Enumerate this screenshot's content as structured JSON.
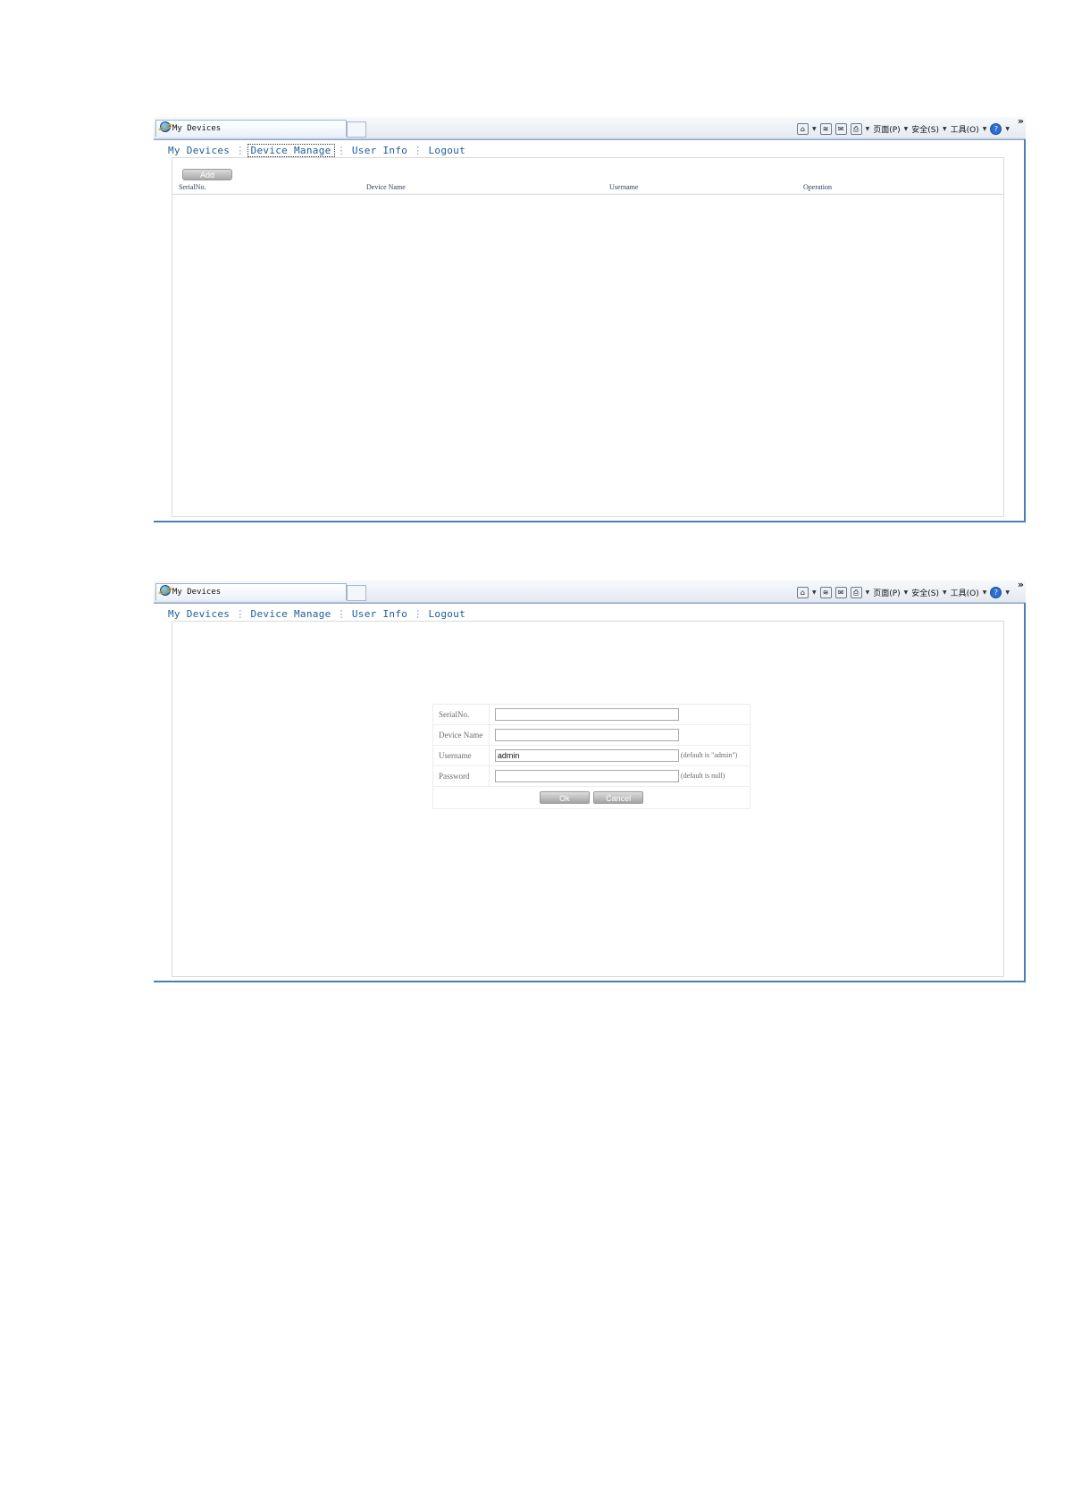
{
  "browser": {
    "tab_title": "My Devices",
    "toolbar": {
      "page_label": "页面(P)",
      "safety_label": "安全(S)",
      "tools_label": "工具(O)",
      "more": "»"
    }
  },
  "nav": {
    "items": [
      "My Devices",
      "Device Manage",
      "User Info",
      "Logout"
    ]
  },
  "list_view": {
    "add_button": "Add",
    "columns": [
      "SerialNo.",
      "Device Name",
      "Username",
      "Operation"
    ],
    "rows": []
  },
  "add_form": {
    "fields": [
      {
        "label": "SerialNo.",
        "value": "",
        "hint": ""
      },
      {
        "label": "Device Name",
        "value": "",
        "hint": ""
      },
      {
        "label": "Username",
        "value": "admin",
        "hint": "(default is \"admin\")"
      },
      {
        "label": "Password",
        "value": "",
        "hint": "(default is null)"
      }
    ],
    "ok_button": "Ok",
    "cancel_button": "Cancel"
  }
}
